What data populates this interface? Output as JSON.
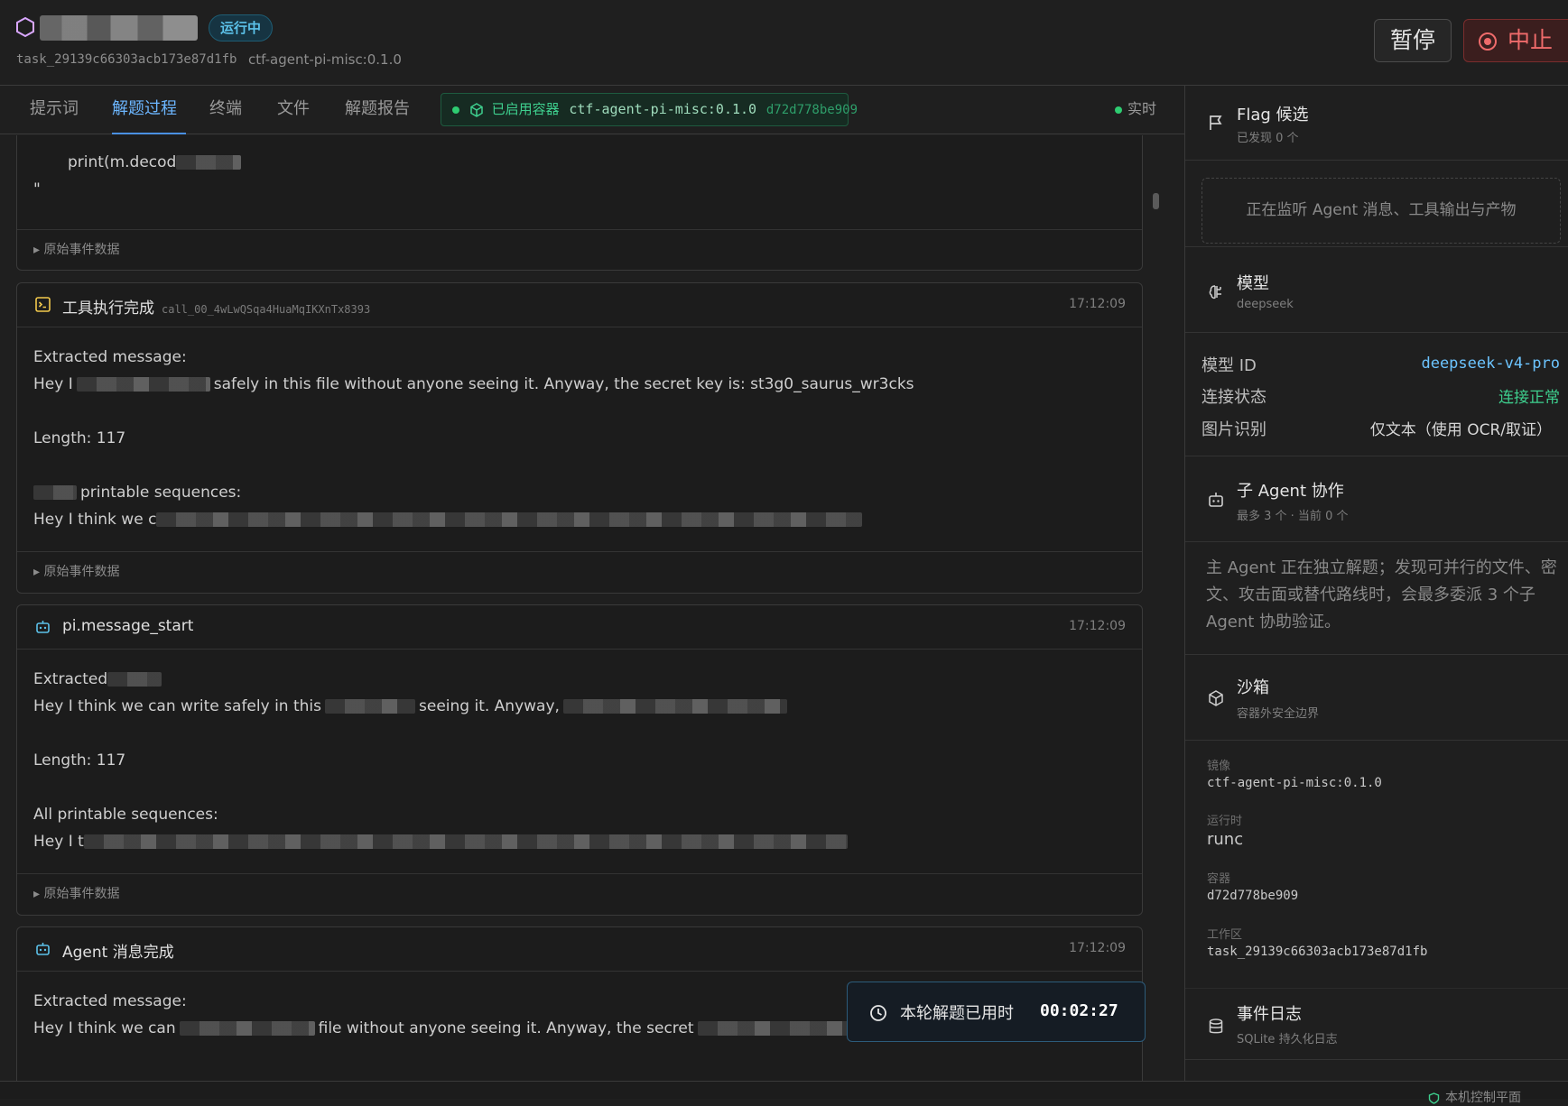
{
  "header": {
    "status": "运行中",
    "task_id": "task_29139c66303acb173e87d1fb",
    "image": "ctf-agent-pi-misc:0.1.0",
    "pause_label": "暂停",
    "stop_label": "中止"
  },
  "tabs": [
    {
      "label": "提示词"
    },
    {
      "label": "解题过程"
    },
    {
      "label": "终端"
    },
    {
      "label": "文件"
    },
    {
      "label": "解题报告"
    }
  ],
  "container_chip": {
    "label": "已启用容器",
    "image": "ctf-agent-pi-misc:0.1.0",
    "id": "d72d778be909"
  },
  "live_label": "实时",
  "cards": [
    {
      "lines": [
        "print(m.decod",
        "\""
      ],
      "footer": "原始事件数据"
    },
    {
      "title": "工具执行完成",
      "call_id": "call_00_4wLwQSqa4HuaMqIKXnTx8393",
      "time": "17:12:09",
      "line1": "Extracted message:",
      "line2a": "Hey I",
      "line2b": "safely in this file without anyone seeing it. Anyway, the secret key is: st3g0_saurus_wr3cks",
      "line3": "Length: 117",
      "line4": "printable sequences:",
      "line5": "Hey I think we c",
      "footer": "原始事件数据"
    },
    {
      "title": "pi.message_start",
      "time": "17:12:09",
      "line1": "Extracted",
      "line2a": "Hey I think we can write safely in this",
      "line2b": "seeing it. Anyway,",
      "line3": "Length: 117",
      "line4": "All printable sequences:",
      "line5": "Hey I t",
      "footer": "原始事件数据"
    },
    {
      "title": "Agent 消息完成",
      "time": "17:12:09",
      "line1": "Extracted message:",
      "line2a": "Hey I think we can",
      "line2b": "file without anyone seeing it. Anyway, the secret"
    }
  ],
  "timer": {
    "label": "本轮解题已用时",
    "value": "00:02:27"
  },
  "sidebar": {
    "flag": {
      "title": "Flag 候选",
      "sub": "已发现 0 个",
      "empty_text": "正在监听 Agent 消息、工具输出与产物"
    },
    "model": {
      "title": "模型",
      "sub": "deepseek",
      "rows": [
        {
          "key": "模型 ID",
          "value": "deepseek-v4-pro"
        },
        {
          "key": "连接状态",
          "value": "连接正常"
        },
        {
          "key": "图片识别",
          "value": "仅文本（使用 OCR/取证）"
        }
      ]
    },
    "subagent": {
      "title": "子 Agent 协作",
      "sub": "最多 3 个 · 当前 0 个",
      "desc": "主 Agent 正在独立解题；发现可并行的文件、密文、攻击面或替代路线时，会最多委派 3 个子 Agent 协助验证。"
    },
    "sandbox": {
      "title": "沙箱",
      "sub": "容器外安全边界",
      "items": [
        {
          "key": "镜像",
          "value": "ctf-agent-pi-misc:0.1.0"
        },
        {
          "key": "运行时",
          "value": "runc"
        },
        {
          "key": "容器",
          "value": "d72d778be909"
        },
        {
          "key": "工作区",
          "value": "task_29139c66303acb173e87d1fb"
        }
      ]
    },
    "events": {
      "title": "事件日志",
      "sub": "SQLite 持久化日志"
    }
  },
  "footer": {
    "control_plane": "本机控制平面"
  },
  "colors": {
    "accent": "#4a90e2",
    "success": "#3ecf8e",
    "danger": "#ef6b6b",
    "badge": "#5cc2ea"
  }
}
